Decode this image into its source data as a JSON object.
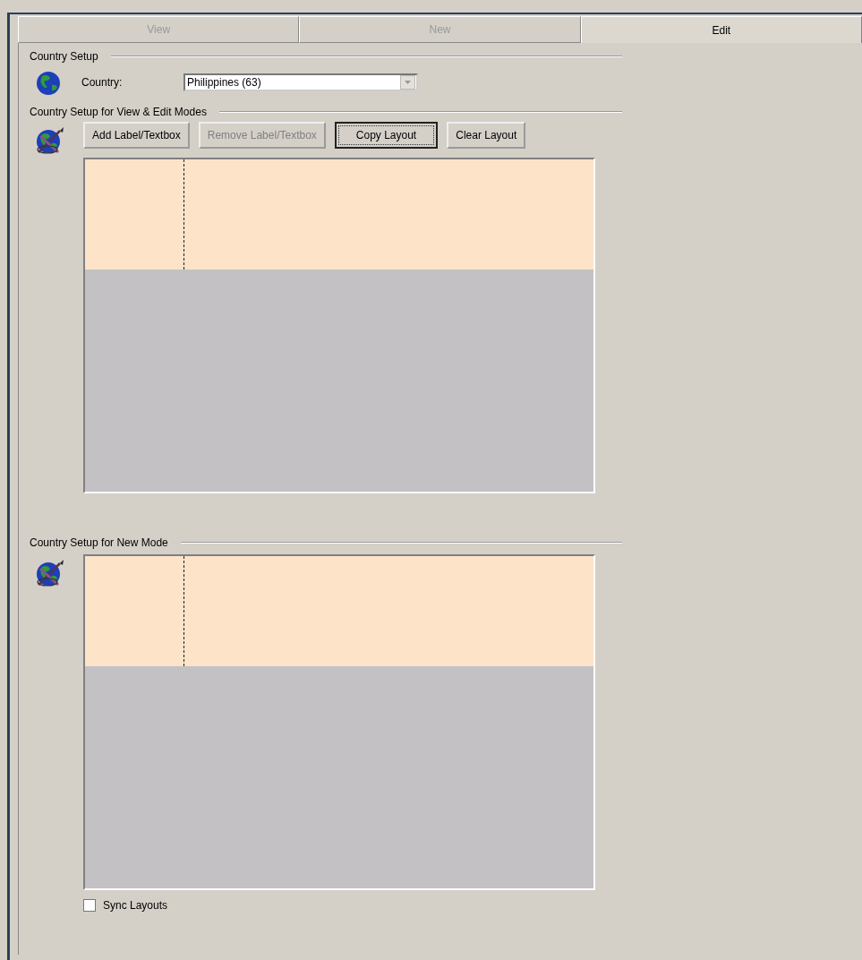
{
  "tabs": [
    {
      "label": "View",
      "selected": false
    },
    {
      "label": "New",
      "selected": false
    },
    {
      "label": "Edit",
      "selected": true
    }
  ],
  "country_setup": {
    "title": "Country Setup",
    "label": "Country:",
    "value": "Philippines (63)"
  },
  "view_edit_setup": {
    "title": "Country Setup for View & Edit Modes",
    "buttons": [
      {
        "label": "Add Label/Textbox",
        "disabled": false,
        "focused": false
      },
      {
        "label": "Remove Label/Textbox",
        "disabled": true,
        "focused": false
      },
      {
        "label": "Copy Layout",
        "disabled": false,
        "focused": true
      },
      {
        "label": "Clear Layout",
        "disabled": false,
        "focused": false
      }
    ]
  },
  "new_setup": {
    "title": "Country Setup for New Mode"
  },
  "sync_layouts": {
    "label": "Sync Layouts",
    "checked": false
  }
}
